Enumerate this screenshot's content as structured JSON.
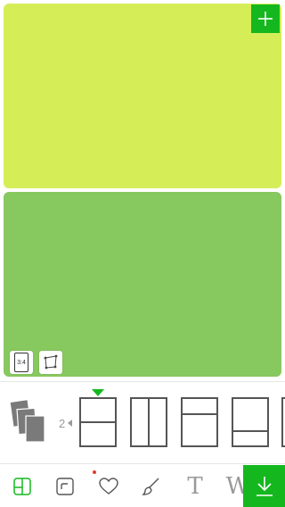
{
  "colors": {
    "panel_top": "#d5ee58",
    "panel_bottom": "#87c85f",
    "accent_green": "#14b81e",
    "notification_dot": "#e53b2a",
    "icon_gray": "#9a9a9a"
  },
  "canvas": {
    "aspect_ratio_label": "3:4",
    "add_button_icon": "plus-icon",
    "crop_button_icon": "free-transform-icon"
  },
  "layout_picker": {
    "photo_count": "2",
    "layouts": [
      {
        "id": "top-bottom-split",
        "selected": true
      },
      {
        "id": "left-right-split",
        "selected": false
      },
      {
        "id": "small-top-large-bottom",
        "selected": false
      },
      {
        "id": "large-top-small-bottom",
        "selected": false
      }
    ]
  },
  "toolbar": {
    "tools": [
      {
        "id": "layout",
        "icon": "layout-grid-icon",
        "active": true
      },
      {
        "id": "border",
        "icon": "border-corner-icon",
        "active": false
      },
      {
        "id": "stickers",
        "icon": "heart-icon",
        "active": false,
        "badge": true
      },
      {
        "id": "brush",
        "icon": "brush-icon",
        "active": false
      },
      {
        "id": "text",
        "label": "T",
        "icon": "text-icon",
        "active": false
      },
      {
        "id": "watermark",
        "label": "W",
        "icon": "watermark-icon",
        "active": false
      }
    ],
    "download_icon": "download-icon"
  }
}
